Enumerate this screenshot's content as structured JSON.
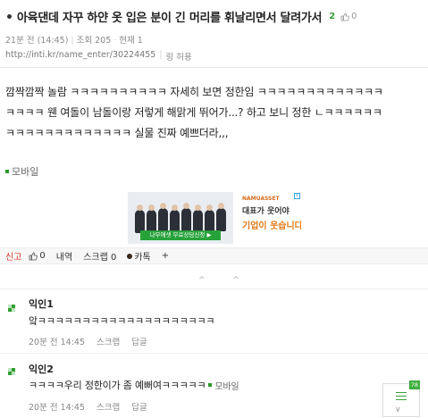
{
  "post": {
    "title": "아육댄데 자꾸 하얀 옷 입은 분이 긴 머리를 휘날리면서 달려가서",
    "comment_count": "2",
    "like_count": "0",
    "time": "21분 전 (14:45)",
    "views": "조회 205",
    "current": "현재 1",
    "url": "http://inti.kr/name_enter/30224455",
    "link_allow": "링 허용",
    "body_lines": [
      "깜짝깜짝 놀람 ㅋㅋㅋㅋㅋㅋㅋㅋㅋㅋ 자세히 보면 정한임 ㅋㅋㅋㅋㅋㅋㅋㅋㅋㅋㅋㅋㅋ",
      "ㅋㅋㅋㅋ 웬 여돌이 남돌이랑 저렇게 해맑게 뛰어가...? 하고 보니 정한 ㄴㅋㅋㅋㅋㅋㅋ",
      "ㅋㅋㅋㅋㅋㅋㅋㅋㅋㅋㅋㅋㅋ 실물 진짜 예쁘더라,,,"
    ],
    "mobile_label": "모바일"
  },
  "ad": {
    "green_text": "나무애셋 무료상담신청 ▶",
    "brand": "NAMUASSET",
    "line1": "대표가 웃어야",
    "line2": "기업이 웃습니다",
    "close": "x"
  },
  "actions": {
    "report": "신고",
    "like": "0",
    "history": "내역",
    "scrap": "스크랩 0",
    "kakao": "카톡",
    "plus": "+"
  },
  "nav": {
    "chevrons": "^ ^"
  },
  "comments": [
    {
      "author": "익인1",
      "text": "앜ㅋㅋㅋㅋㅋㅋㅋㅋㅋㅋㅋㅋㅋㅋㅋㅋㅋㅋㅋㅋ",
      "time": "20분 전 14:45",
      "scrap": "스크랩",
      "reply": "답글"
    },
    {
      "author": "익인2",
      "text": "ㅋㅋㅋㅋ우리 정한이가 좀 예뻐여ㅋㅋㅋㅋㅋ",
      "mobile": "모바일",
      "time": "20분 전 14:45",
      "scrap": "스크랩",
      "reply": "답글"
    }
  ],
  "float": {
    "badge": "78",
    "down": "∨"
  },
  "colors": {
    "accent": "#30a030",
    "report": "#d9322b",
    "ad_orange": "#e07a18"
  },
  "icons": {
    "like": "thumbs-up-icon",
    "mobile": "mobile-square-icon",
    "kakao": "kakao-dot-icon",
    "comment_author": "green-grid-icon"
  }
}
